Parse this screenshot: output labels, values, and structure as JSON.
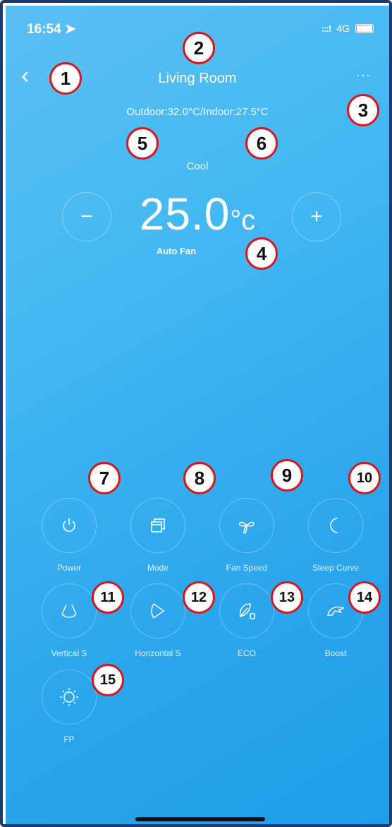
{
  "status": {
    "time": "16:54",
    "signal": ":::!",
    "network": "4G"
  },
  "header": {
    "back_icon": "‹",
    "title": "Living Room",
    "more": "···"
  },
  "temps": "Outdoor:32.0°C/Indoor:27.5°C",
  "mode_label": "Cool",
  "setpoint": {
    "value": "25.0",
    "unit": "°c",
    "minus": "−",
    "plus": "+"
  },
  "fan_label": "Auto Fan",
  "controls": [
    {
      "label": "Power",
      "icon": "power-icon"
    },
    {
      "label": "Mode",
      "icon": "mode-icon"
    },
    {
      "label": "Fan Speed",
      "icon": "fan-icon"
    },
    {
      "label": "Sleep Curve",
      "icon": "moon-icon"
    },
    {
      "label": "Vertical S",
      "icon": "vertical-swing-icon"
    },
    {
      "label": "Horizontal S",
      "icon": "horizontal-swing-icon"
    },
    {
      "label": "ECO",
      "icon": "eco-icon"
    },
    {
      "label": "Boost",
      "icon": "boost-icon"
    },
    {
      "label": "FP",
      "icon": "sun-icon"
    }
  ],
  "annotations": [
    "1",
    "2",
    "3",
    "4",
    "5",
    "6",
    "7",
    "8",
    "9",
    "10",
    "11",
    "12",
    "13",
    "14",
    "15"
  ]
}
